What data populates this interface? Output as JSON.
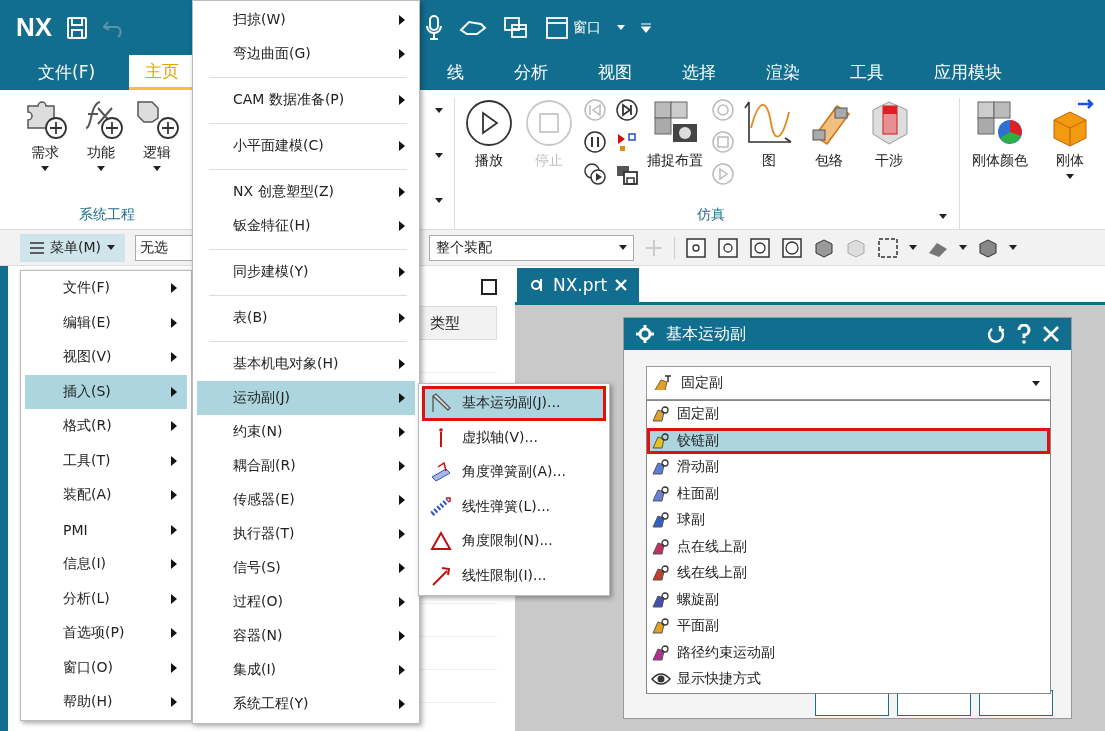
{
  "title_bar": {
    "logo": "NX",
    "window_menu": "窗口"
  },
  "ribbon_tabs": [
    {
      "label": "文件(F)",
      "selected": false
    },
    {
      "label": "主页",
      "selected": true
    },
    {
      "label": "线",
      "selected": false
    },
    {
      "label": "分析",
      "selected": false
    },
    {
      "label": "视图",
      "selected": false
    },
    {
      "label": "选择",
      "selected": false
    },
    {
      "label": "渲染",
      "selected": false
    },
    {
      "label": "工具",
      "selected": false
    },
    {
      "label": "应用模块",
      "selected": false
    }
  ],
  "ribbon": {
    "system_engineering": {
      "label": "系统工程",
      "buttons": [
        {
          "label": "需求"
        },
        {
          "label": "功能"
        },
        {
          "label": "逻辑"
        }
      ]
    },
    "simulation": {
      "label": "仿真",
      "buttons": [
        {
          "label": "播放",
          "disabled": false
        },
        {
          "label": "停止",
          "disabled": true
        },
        {
          "label": "捕捉布置",
          "disabled": false
        },
        {
          "label": "图",
          "disabled": false
        },
        {
          "label": "包络",
          "disabled": false
        },
        {
          "label": "干涉",
          "disabled": false
        }
      ]
    },
    "rigid_body": {
      "buttons": [
        {
          "label": "刚体颜色"
        },
        {
          "label": "刚体"
        }
      ]
    }
  },
  "toolbar": {
    "menu_button": "菜单(M)",
    "selection_filter": "无选",
    "assembly_scope": "整个装配"
  },
  "navigator": {
    "column_header": "类型"
  },
  "document_tabs": [
    {
      "label": "NX.prt",
      "selected": true
    }
  ],
  "main_menu": [
    {
      "label": "文件(F)",
      "selected": false
    },
    {
      "label": "编辑(E)",
      "selected": false
    },
    {
      "label": "视图(V)",
      "selected": false
    },
    {
      "label": "插入(S)",
      "selected": true
    },
    {
      "label": "格式(R)",
      "selected": false
    },
    {
      "label": "工具(T)",
      "selected": false
    },
    {
      "label": "装配(A)",
      "selected": false
    },
    {
      "label": "PMI",
      "selected": false
    },
    {
      "label": "信息(I)",
      "selected": false
    },
    {
      "label": "分析(L)",
      "selected": false
    },
    {
      "label": "首选项(P)",
      "selected": false
    },
    {
      "label": "窗口(O)",
      "selected": false
    },
    {
      "label": "帮助(H)",
      "selected": false
    }
  ],
  "insert_menu": [
    {
      "kind": "item",
      "label": "扫掠(W)",
      "selected": false
    },
    {
      "kind": "item",
      "label": "弯边曲面(G)",
      "selected": false
    },
    {
      "kind": "separator"
    },
    {
      "kind": "item",
      "label": "CAM 数据准备(P)",
      "selected": false
    },
    {
      "kind": "separator"
    },
    {
      "kind": "item",
      "label": "小平面建模(C)",
      "selected": false
    },
    {
      "kind": "separator"
    },
    {
      "kind": "item",
      "label": "NX 创意塑型(Z)",
      "selected": false
    },
    {
      "kind": "item",
      "label": "钣金特征(H)",
      "selected": false
    },
    {
      "kind": "separator"
    },
    {
      "kind": "item",
      "label": "同步建模(Y)",
      "selected": false
    },
    {
      "kind": "separator"
    },
    {
      "kind": "item",
      "label": "表(B)",
      "selected": false
    },
    {
      "kind": "separator"
    },
    {
      "kind": "item",
      "label": "基本机电对象(H)",
      "selected": false
    },
    {
      "kind": "item",
      "label": "运动副(J)",
      "selected": true
    },
    {
      "kind": "item",
      "label": "约束(N)",
      "selected": false
    },
    {
      "kind": "item",
      "label": "耦合副(R)",
      "selected": false
    },
    {
      "kind": "item",
      "label": "传感器(E)",
      "selected": false
    },
    {
      "kind": "item",
      "label": "执行器(T)",
      "selected": false
    },
    {
      "kind": "item",
      "label": "信号(S)",
      "selected": false
    },
    {
      "kind": "item",
      "label": "过程(O)",
      "selected": false
    },
    {
      "kind": "item",
      "label": "容器(N)",
      "selected": false
    },
    {
      "kind": "item",
      "label": "集成(I)",
      "selected": false
    },
    {
      "kind": "item",
      "label": "系统工程(Y)",
      "selected": false
    }
  ],
  "joint_menu": [
    {
      "label": "基本运动副(J)...",
      "selected": true,
      "highlighted": true
    },
    {
      "label": "虚拟轴(V)...",
      "selected": false,
      "highlighted": false
    },
    {
      "label": "角度弹簧副(A)...",
      "selected": false,
      "highlighted": false
    },
    {
      "label": "线性弹簧(L)...",
      "selected": false,
      "highlighted": false
    },
    {
      "label": "角度限制(N)...",
      "selected": false,
      "highlighted": false
    },
    {
      "label": "线性限制(I)...",
      "selected": false,
      "highlighted": false
    }
  ],
  "dialog": {
    "title": "基本运动副",
    "type_value": "固定副",
    "options": [
      {
        "label": "固定副",
        "selected": false,
        "highlighted": false
      },
      {
        "label": "铰链副",
        "selected": true,
        "highlighted": true
      },
      {
        "label": "滑动副",
        "selected": false,
        "highlighted": false
      },
      {
        "label": "柱面副",
        "selected": false,
        "highlighted": false
      },
      {
        "label": "球副",
        "selected": false,
        "highlighted": false
      },
      {
        "label": "点在线上副",
        "selected": false,
        "highlighted": false
      },
      {
        "label": "线在线上副",
        "selected": false,
        "highlighted": false
      },
      {
        "label": "螺旋副",
        "selected": false,
        "highlighted": false
      },
      {
        "label": "平面副",
        "selected": false,
        "highlighted": false
      },
      {
        "label": "路径约束运动副",
        "selected": false,
        "highlighted": false
      },
      {
        "label": "显示快捷方式",
        "selected": false,
        "highlighted": false
      }
    ]
  }
}
